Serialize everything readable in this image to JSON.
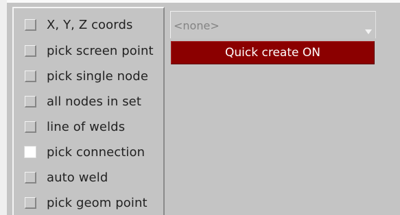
{
  "options": [
    {
      "label": "X, Y, Z coords",
      "checked": false
    },
    {
      "label": "pick screen point",
      "checked": false
    },
    {
      "label": "pick single node",
      "checked": false
    },
    {
      "label": "all nodes in set",
      "checked": false
    },
    {
      "label": "line of welds",
      "checked": false
    },
    {
      "label": "pick connection",
      "checked": true
    },
    {
      "label": "auto weld",
      "checked": false
    },
    {
      "label": "pick geom point",
      "checked": false
    }
  ],
  "selector": {
    "value": "<none>",
    "arrow_icon": "triangle-down-icon"
  },
  "quick_create": {
    "label": "Quick create ON",
    "color": "#8b0000"
  }
}
